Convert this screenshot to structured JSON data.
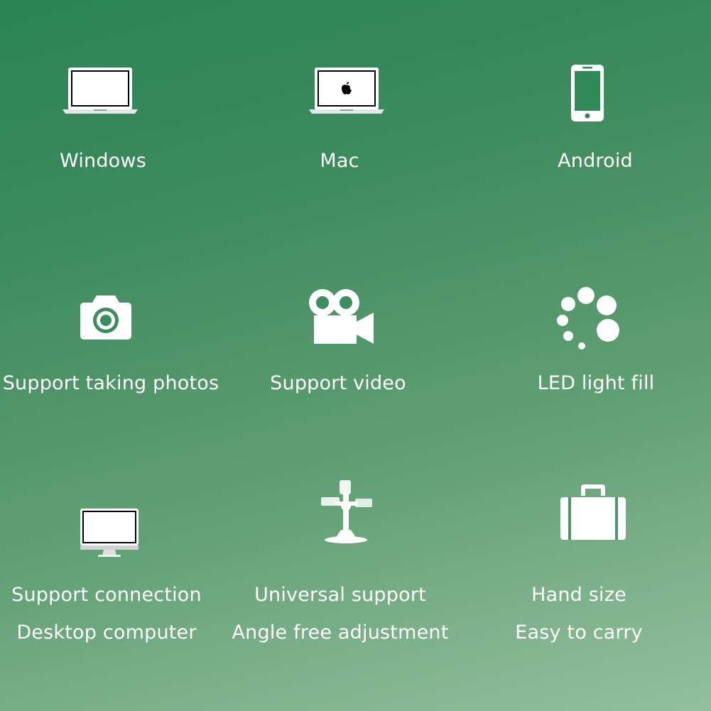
{
  "features": [
    {
      "label": "Windows",
      "icon": "windows-laptop-icon"
    },
    {
      "label": "Mac",
      "icon": "macbook-icon"
    },
    {
      "label": "Android",
      "icon": "smartphone-icon"
    },
    {
      "label": "Support taking photos",
      "icon": "camera-icon"
    },
    {
      "label": "Support video",
      "icon": "video-camera-icon"
    },
    {
      "label": "LED light fill",
      "icon": "led-dots-icon"
    },
    {
      "label": "Support connection",
      "label2": "Desktop computer",
      "icon": "desktop-monitor-icon"
    },
    {
      "label": "Universal support",
      "label2": "Angle free adjustment",
      "icon": "adjustable-stand-icon"
    },
    {
      "label": "Hand size",
      "label2": "Easy to carry",
      "icon": "suitcase-icon"
    }
  ],
  "colors": {
    "background_top": "#2a8453",
    "background_bottom": "#93bf9c",
    "foreground": "#ffffff"
  }
}
